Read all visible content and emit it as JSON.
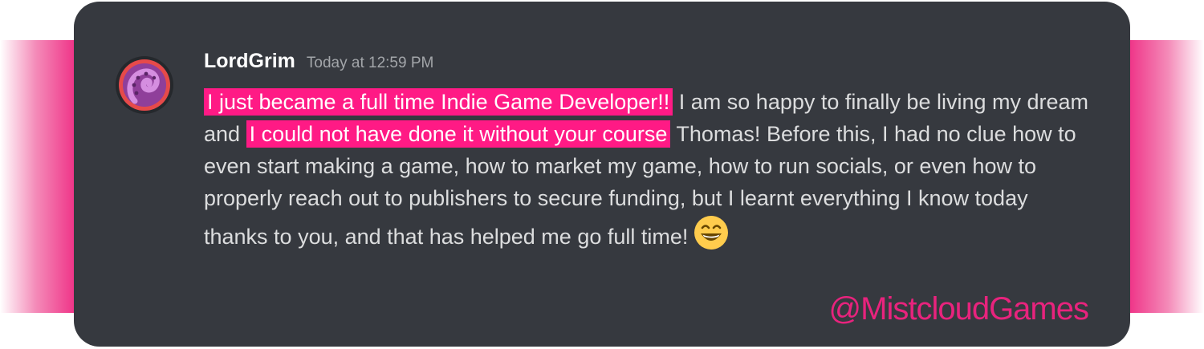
{
  "colors": {
    "band": "#ee1f7c",
    "card_background": "#36393f",
    "highlight": "#ff1a85",
    "username": "#ffffff",
    "timestamp": "#a3a6aa",
    "message_text": "#dcddde",
    "watermark": "#e8237d"
  },
  "message": {
    "avatar_icon": "tentacle-avatar-icon",
    "username": "LordGrim",
    "timestamp": "Today at 12:59 PM",
    "segments": {
      "s1": "I just became a full time Indie Game Developer!!",
      "s2": " I am so happy to finally be living my dream and ",
      "s3": "I could not have done it without your course",
      "s4": " Thomas! Before this, I had no clue how to even start making a game, how to market my game, how to run socials, or even how to properly reach out to publishers to secure funding, but I learnt everything I know today thanks to you, and that has helped me go full time!"
    },
    "emoji_icon": "grinning-face-emoji-icon"
  },
  "watermark": "@MistcloudGames"
}
